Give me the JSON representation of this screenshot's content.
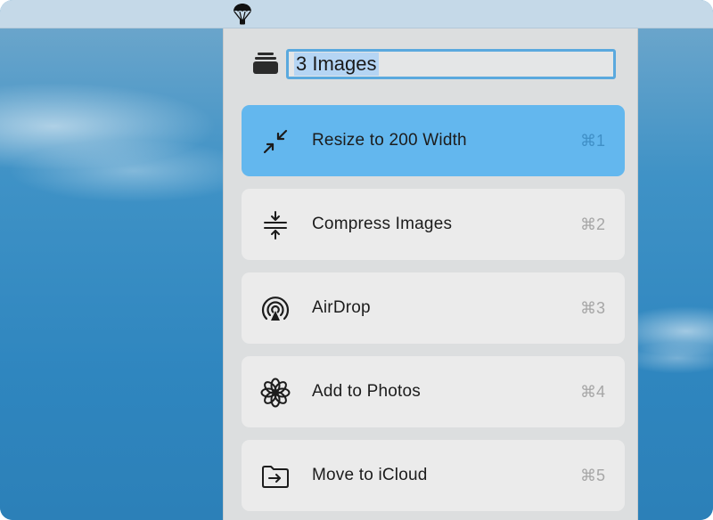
{
  "header": {
    "selection_name": "3 Images"
  },
  "actions": [
    {
      "label": "Resize to 200 Width",
      "shortcut": "⌘1",
      "icon": "resize-arrows-icon",
      "active": true
    },
    {
      "label": "Compress Images",
      "shortcut": "⌘2",
      "icon": "compress-icon",
      "active": false
    },
    {
      "label": "AirDrop",
      "shortcut": "⌘3",
      "icon": "airdrop-icon",
      "active": false
    },
    {
      "label": "Add to Photos",
      "shortcut": "⌘4",
      "icon": "photos-flower-icon",
      "active": false
    },
    {
      "label": "Move to iCloud",
      "shortcut": "⌘5",
      "icon": "folder-arrow-icon",
      "active": false
    }
  ],
  "colors": {
    "accent": "#63b7ee",
    "selection_border": "#5aa9de",
    "panel_bg": "#dcdedf",
    "row_bg": "#ebebeb"
  }
}
